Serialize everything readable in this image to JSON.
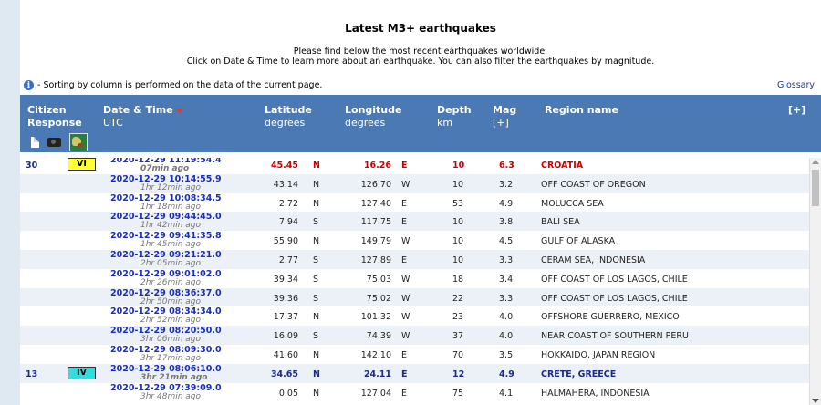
{
  "title": "Latest M3+ earthquakes",
  "intro": {
    "line1": "Please find below the most recent earthquakes worldwide.",
    "line2": "Click on Date & Time to learn more about an earthquake. You can also filter the earthquakes by magnitude."
  },
  "info_text": "- Sorting by column is performed on the data of the current page.",
  "glossary": "Glossary",
  "header": {
    "citizen": "Citizen",
    "response": "Response",
    "datetime": "Date & Time",
    "utc": "UTC",
    "latitude": "Latitude",
    "lat_unit": "degrees",
    "longitude": "Longitude",
    "lon_unit": "degrees",
    "depth": "Depth",
    "depth_unit": "km",
    "mag": "Mag",
    "mag_plus": "[+]",
    "region": "Region name",
    "expand": "[+]"
  },
  "icons": [
    "document-icon",
    "camera-icon",
    "map-icon"
  ],
  "rows": [
    {
      "response": "30",
      "intensity": "VI",
      "intensity_color": "#ffff33",
      "datetime": "2020-12-29   11:19:54.4",
      "ago": "07min ago",
      "lat": "45.45",
      "lat_dir": "N",
      "lon": "16.26",
      "lon_dir": "E",
      "depth": "10",
      "mag": "6.3",
      "region": "CROATIA",
      "style": "felt"
    },
    {
      "response": "",
      "intensity": "",
      "datetime": "2020-12-29   10:14:55.9",
      "ago": "1hr 12min ago",
      "lat": "43.14",
      "lat_dir": "N",
      "lon": "126.70",
      "lon_dir": "W",
      "depth": "10",
      "mag": "3.2",
      "region": "OFF COAST OF OREGON",
      "style": ""
    },
    {
      "response": "",
      "intensity": "",
      "datetime": "2020-12-29   10:08:34.5",
      "ago": "1hr 18min ago",
      "lat": "2.72",
      "lat_dir": "N",
      "lon": "127.40",
      "lon_dir": "E",
      "depth": "53",
      "mag": "4.9",
      "region": "MOLUCCA SEA",
      "style": ""
    },
    {
      "response": "",
      "intensity": "",
      "datetime": "2020-12-29   09:44:45.0",
      "ago": "1hr 42min ago",
      "lat": "7.94",
      "lat_dir": "S",
      "lon": "117.75",
      "lon_dir": "E",
      "depth": "10",
      "mag": "3.8",
      "region": "BALI SEA",
      "style": ""
    },
    {
      "response": "",
      "intensity": "",
      "datetime": "2020-12-29   09:41:35.8",
      "ago": "1hr 45min ago",
      "lat": "55.90",
      "lat_dir": "N",
      "lon": "149.79",
      "lon_dir": "W",
      "depth": "10",
      "mag": "4.5",
      "region": "GULF OF ALASKA",
      "style": ""
    },
    {
      "response": "",
      "intensity": "",
      "datetime": "2020-12-29   09:21:21.0",
      "ago": "2hr 05min ago",
      "lat": "2.77",
      "lat_dir": "S",
      "lon": "127.89",
      "lon_dir": "E",
      "depth": "10",
      "mag": "3.3",
      "region": "CERAM SEA, INDONESIA",
      "style": ""
    },
    {
      "response": "",
      "intensity": "",
      "datetime": "2020-12-29   09:01:02.0",
      "ago": "2hr 26min ago",
      "lat": "39.34",
      "lat_dir": "S",
      "lon": "75.03",
      "lon_dir": "W",
      "depth": "18",
      "mag": "3.4",
      "region": "OFF COAST OF LOS LAGOS, CHILE",
      "style": ""
    },
    {
      "response": "",
      "intensity": "",
      "datetime": "2020-12-29   08:36:37.0",
      "ago": "2hr 50min ago",
      "lat": "39.36",
      "lat_dir": "S",
      "lon": "75.02",
      "lon_dir": "W",
      "depth": "22",
      "mag": "3.3",
      "region": "OFF COAST OF LOS LAGOS, CHILE",
      "style": ""
    },
    {
      "response": "",
      "intensity": "",
      "datetime": "2020-12-29   08:34:34.0",
      "ago": "2hr 52min ago",
      "lat": "17.37",
      "lat_dir": "N",
      "lon": "101.32",
      "lon_dir": "W",
      "depth": "23",
      "mag": "4.0",
      "region": "OFFSHORE GUERRERO, MEXICO",
      "style": ""
    },
    {
      "response": "",
      "intensity": "",
      "datetime": "2020-12-29   08:20:50.0",
      "ago": "3hr 06min ago",
      "lat": "16.09",
      "lat_dir": "S",
      "lon": "74.39",
      "lon_dir": "W",
      "depth": "37",
      "mag": "4.0",
      "region": "NEAR COAST OF SOUTHERN PERU",
      "style": ""
    },
    {
      "response": "",
      "intensity": "",
      "datetime": "2020-12-29   08:09:30.0",
      "ago": "3hr 17min ago",
      "lat": "41.60",
      "lat_dir": "N",
      "lon": "142.10",
      "lon_dir": "E",
      "depth": "70",
      "mag": "3.5",
      "region": "HOKKAIDO, JAPAN REGION",
      "style": ""
    },
    {
      "response": "13",
      "intensity": "IV",
      "intensity_color": "#33dddd",
      "datetime": "2020-12-29   08:06:10.0",
      "ago": "3hr 21min ago",
      "lat": "34.65",
      "lat_dir": "N",
      "lon": "24.11",
      "lon_dir": "E",
      "depth": "12",
      "mag": "4.9",
      "region": "CRETE, GREECE",
      "style": "felt2"
    },
    {
      "response": "",
      "intensity": "",
      "datetime": "2020-12-29   07:39:09.0",
      "ago": "3hr 48min ago",
      "lat": "0.05",
      "lat_dir": "N",
      "lon": "127.04",
      "lon_dir": "E",
      "depth": "75",
      "mag": "4.1",
      "region": "HALMAHERA, INDONESIA",
      "style": ""
    }
  ]
}
